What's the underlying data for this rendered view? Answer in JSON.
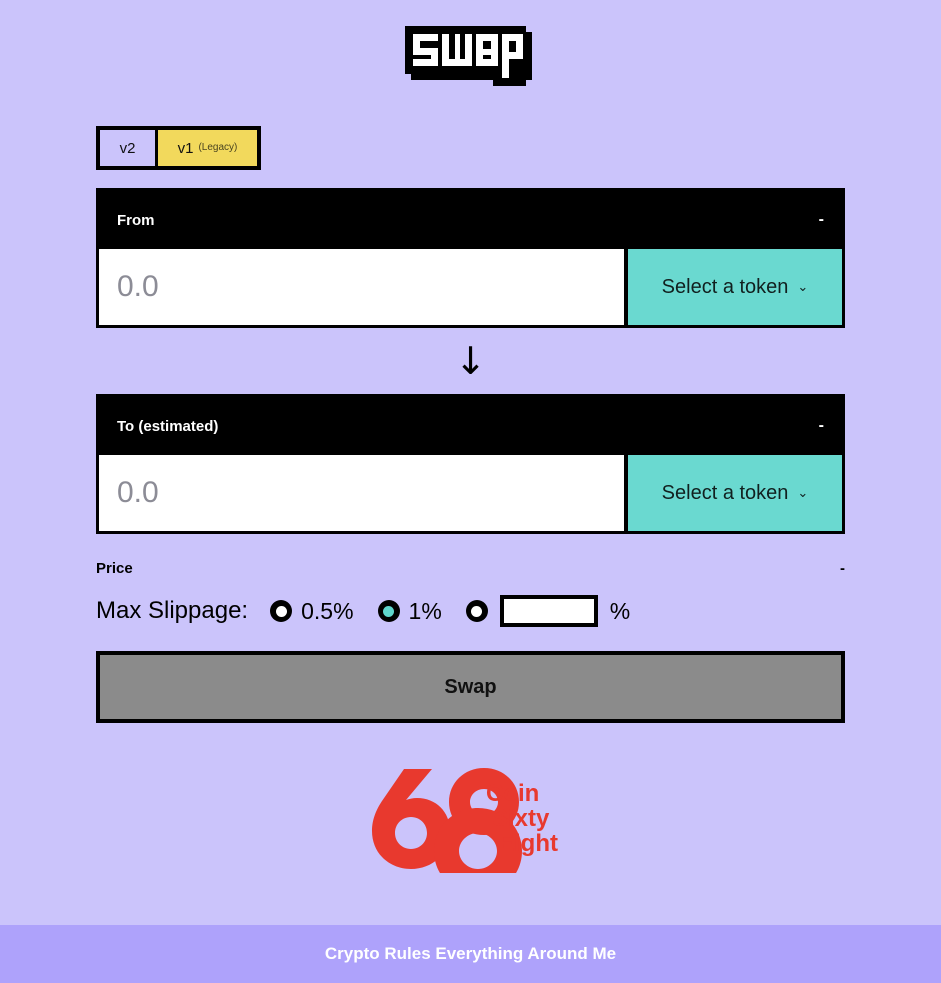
{
  "page": {
    "background_color": "#cbc4fb",
    "title_text": "swap"
  },
  "version_tabs": {
    "v2": {
      "label": "v2",
      "selected": false
    },
    "v1": {
      "label": "v1",
      "sub_label": "(Legacy)",
      "selected": true,
      "color": "#f2d95c"
    }
  },
  "from_panel": {
    "header_label": "From",
    "balance": "-",
    "amount_value": "",
    "amount_placeholder": "0.0",
    "token_button_label": "Select a token",
    "token_button_color": "#6ad9d0",
    "chevron": "⌄"
  },
  "arrow": {
    "glyph": "↓"
  },
  "to_panel": {
    "header_label": "To (estimated)",
    "balance": "-",
    "amount_value": "",
    "amount_placeholder": "0.0",
    "token_button_label": "Select a token",
    "token_button_color": "#6ad9d0",
    "chevron": "⌄"
  },
  "price": {
    "label": "Price",
    "value": "-"
  },
  "slippage": {
    "label": "Max Slippage:",
    "options": [
      {
        "label": "0.5%",
        "selected": false
      },
      {
        "label": "1%",
        "selected": true
      }
    ],
    "custom": {
      "selected": false,
      "value": "",
      "placeholder": "",
      "suffix": "%"
    },
    "selected_color": "#5fd6cd"
  },
  "swap_action": {
    "label": "Swap",
    "disabled": true,
    "color": "#8b8b8b"
  },
  "brand": {
    "name_lines": [
      "Coin",
      "Sixty",
      "Eight"
    ],
    "color": "#e8392e"
  },
  "footer": {
    "text": "Crypto Rules Everything Around Me",
    "background_color": "#aea2fb"
  }
}
